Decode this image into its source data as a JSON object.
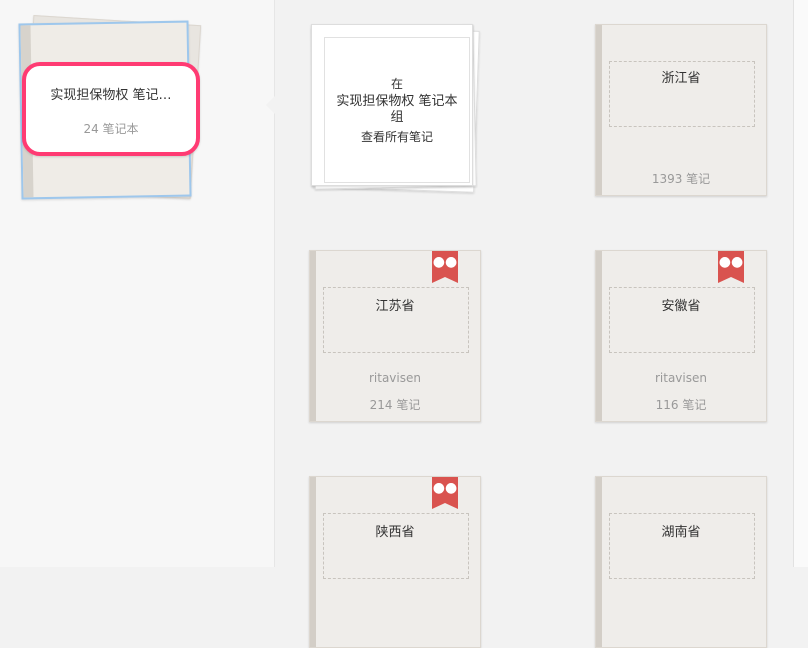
{
  "selected_stack": {
    "title": "实现担保物权 笔记…",
    "count": "24 笔记本"
  },
  "group": {
    "line1": "在",
    "line2": "实现担保物权 笔记本组",
    "line3": "查看所有笔记"
  },
  "notebooks": [
    {
      "title": "浙江省",
      "owner": "",
      "count": "1393 笔记",
      "shared": false
    },
    {
      "title": "江苏省",
      "owner": "ritavisen",
      "count": "214 笔记",
      "shared": true
    },
    {
      "title": "安徽省",
      "owner": "ritavisen",
      "count": "116 笔记",
      "shared": true
    },
    {
      "title": "陕西省",
      "owner": "",
      "count": "",
      "shared": true
    },
    {
      "title": "湖南省",
      "owner": "",
      "count": "",
      "shared": false
    }
  ],
  "icons": {
    "shared": "users-icon"
  },
  "colors": {
    "selection_ring": "#ff3b73",
    "selection_border": "#9ec7ec",
    "shared_badge": "#d9534f"
  }
}
